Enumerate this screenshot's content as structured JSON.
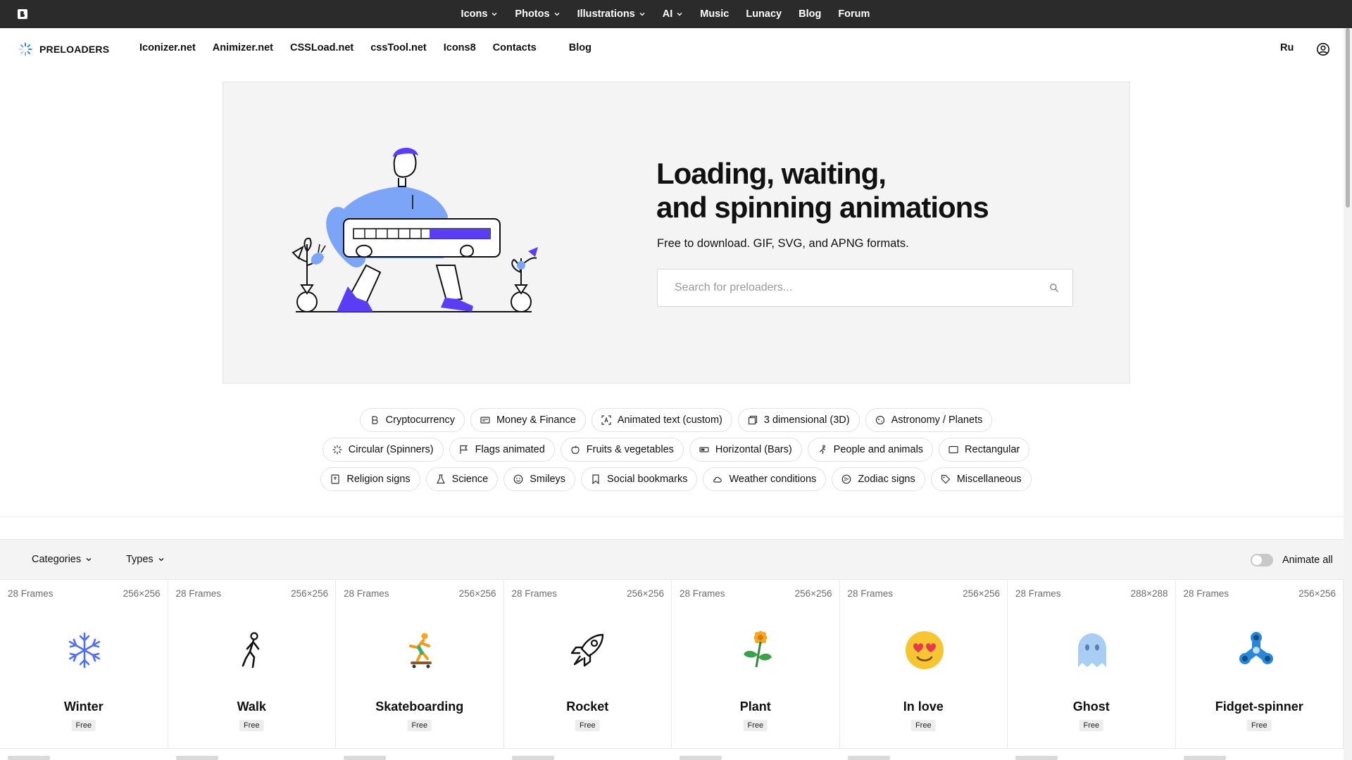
{
  "topbar": {
    "items": [
      {
        "label": "Icons",
        "dropdown": true
      },
      {
        "label": "Photos",
        "dropdown": true
      },
      {
        "label": "Illustrations",
        "dropdown": true
      },
      {
        "label": "AI",
        "dropdown": true
      },
      {
        "label": "Music",
        "dropdown": false
      },
      {
        "label": "Lunacy",
        "dropdown": false
      },
      {
        "label": "Blog",
        "dropdown": false
      },
      {
        "label": "Forum",
        "dropdown": false
      }
    ]
  },
  "subnav": {
    "brand": "PRELOADERS",
    "links": [
      "Iconizer.net",
      "Animizer.net",
      "CSSLoad.net",
      "cssTool.net",
      "Icons8",
      "Contacts",
      "Blog"
    ],
    "lang": "Ru"
  },
  "hero": {
    "title_line1": "Loading, waiting,",
    "title_line2": "and spinning animations",
    "subtitle": "Free to download. GIF, SVG, and APNG formats.",
    "search_placeholder": "Search for preloaders..."
  },
  "chips": {
    "row1": [
      {
        "label": "Cryptocurrency",
        "icon": "bitcoin-icon"
      },
      {
        "label": "Money & Finance",
        "icon": "money-icon"
      },
      {
        "label": "Animated text (custom)",
        "icon": "text-icon"
      },
      {
        "label": "3 dimensional (3D)",
        "icon": "cube-icon"
      },
      {
        "label": "Astronomy / Planets",
        "icon": "planet-icon"
      }
    ],
    "row2": [
      {
        "label": "Circular (Spinners)",
        "icon": "spinner-icon"
      },
      {
        "label": "Flags animated",
        "icon": "flag-icon"
      },
      {
        "label": "Fruits & vegetables",
        "icon": "fruit-icon"
      },
      {
        "label": "Horizontal (Bars)",
        "icon": "bar-icon"
      },
      {
        "label": "People and animals",
        "icon": "people-icon"
      },
      {
        "label": "Rectangular",
        "icon": "rectangle-icon"
      }
    ],
    "row3": [
      {
        "label": "Religion signs",
        "icon": "book-icon"
      },
      {
        "label": "Science",
        "icon": "flask-icon"
      },
      {
        "label": "Smileys",
        "icon": "smiley-icon"
      },
      {
        "label": "Social bookmarks",
        "icon": "bookmark-icon"
      },
      {
        "label": "Weather conditions",
        "icon": "cloud-icon"
      },
      {
        "label": "Zodiac signs",
        "icon": "zodiac-icon"
      },
      {
        "label": "Miscellaneous",
        "icon": "tag-icon"
      }
    ]
  },
  "filters": {
    "categories": "Categories",
    "types": "Types",
    "animate_all": "Animate all",
    "animate_all_on": false
  },
  "cards": [
    {
      "frames": "28 Frames",
      "size": "256×256",
      "name": "Winter",
      "badge": "Free",
      "icon": "snowflake-icon"
    },
    {
      "frames": "28 Frames",
      "size": "256×256",
      "name": "Walk",
      "badge": "Free",
      "icon": "walker-icon"
    },
    {
      "frames": "28 Frames",
      "size": "256×256",
      "name": "Skateboarding",
      "badge": "Free",
      "icon": "skateboarder-icon"
    },
    {
      "frames": "28 Frames",
      "size": "256×256",
      "name": "Rocket",
      "badge": "Free",
      "icon": "rocket-icon"
    },
    {
      "frames": "28 Frames",
      "size": "256×256",
      "name": "Plant",
      "badge": "Free",
      "icon": "plant-icon"
    },
    {
      "frames": "28 Frames",
      "size": "256×256",
      "name": "In love",
      "badge": "Free",
      "icon": "heart-eyes-icon"
    },
    {
      "frames": "28 Frames",
      "size": "288×288",
      "name": "Ghost",
      "badge": "Free",
      "icon": "ghost-icon"
    },
    {
      "frames": "28 Frames",
      "size": "256×256",
      "name": "Fidget-spinner",
      "badge": "Free",
      "icon": "fidget-spinner-icon"
    }
  ],
  "colors": {
    "topbar_bg": "#2b2b2b",
    "accent_purple": "#5b3df5",
    "accent_blue": "#7da5f7",
    "hero_bg": "#f4f4f4"
  }
}
